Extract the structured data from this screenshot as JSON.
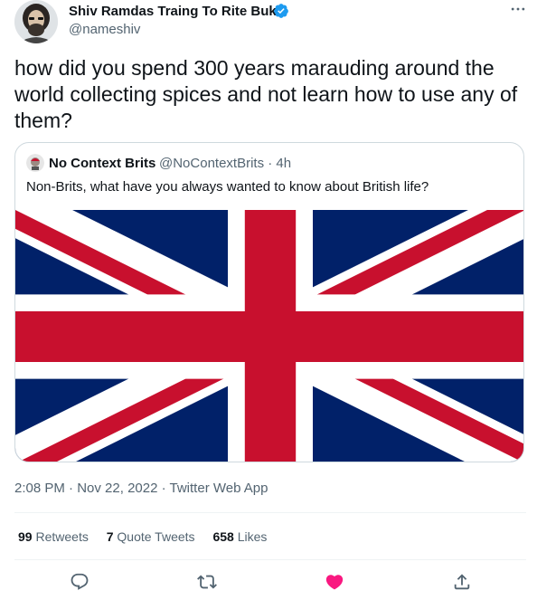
{
  "author": {
    "display_name": "Shiv Ramdas Traing To Rite Buk",
    "handle": "@nameshiv",
    "avatar_icon": "avatar-icon",
    "verified_icon": "verified-badge-icon"
  },
  "more_icon": "more-options-icon",
  "tweet": {
    "text": "how did you spend 300 years marauding around the world collecting spices and not learn how to use any of them?"
  },
  "quoted": {
    "display_name": "No Context Brits",
    "handle_time": "@NoContextBrits · 4h",
    "text": "Non-Brits, what have you always wanted to know about British life?",
    "image": "union-jack-flag",
    "colors": {
      "blue": "#012169",
      "red": "#C8102E",
      "white": "#FFFFFF"
    }
  },
  "meta": {
    "time": "2:08 PM",
    "sep1": " · ",
    "date": "Nov 22, 2022",
    "sep2": " · ",
    "source": "Twitter Web App"
  },
  "stats": {
    "retweets_count": "99",
    "retweets_label": "Retweets",
    "quotes_count": "7",
    "quotes_label": "Quote Tweets",
    "likes_count": "658",
    "likes_label": "Likes"
  },
  "actions": {
    "reply_icon": "reply-icon",
    "retweet_icon": "retweet-icon",
    "like_icon": "like-icon",
    "share_icon": "share-icon",
    "like_active": true
  },
  "colors": {
    "text": "#0f1419",
    "secondary": "#536471",
    "accent": "#1d9bf0",
    "like": "#f91880",
    "border": "#cfd9de"
  }
}
